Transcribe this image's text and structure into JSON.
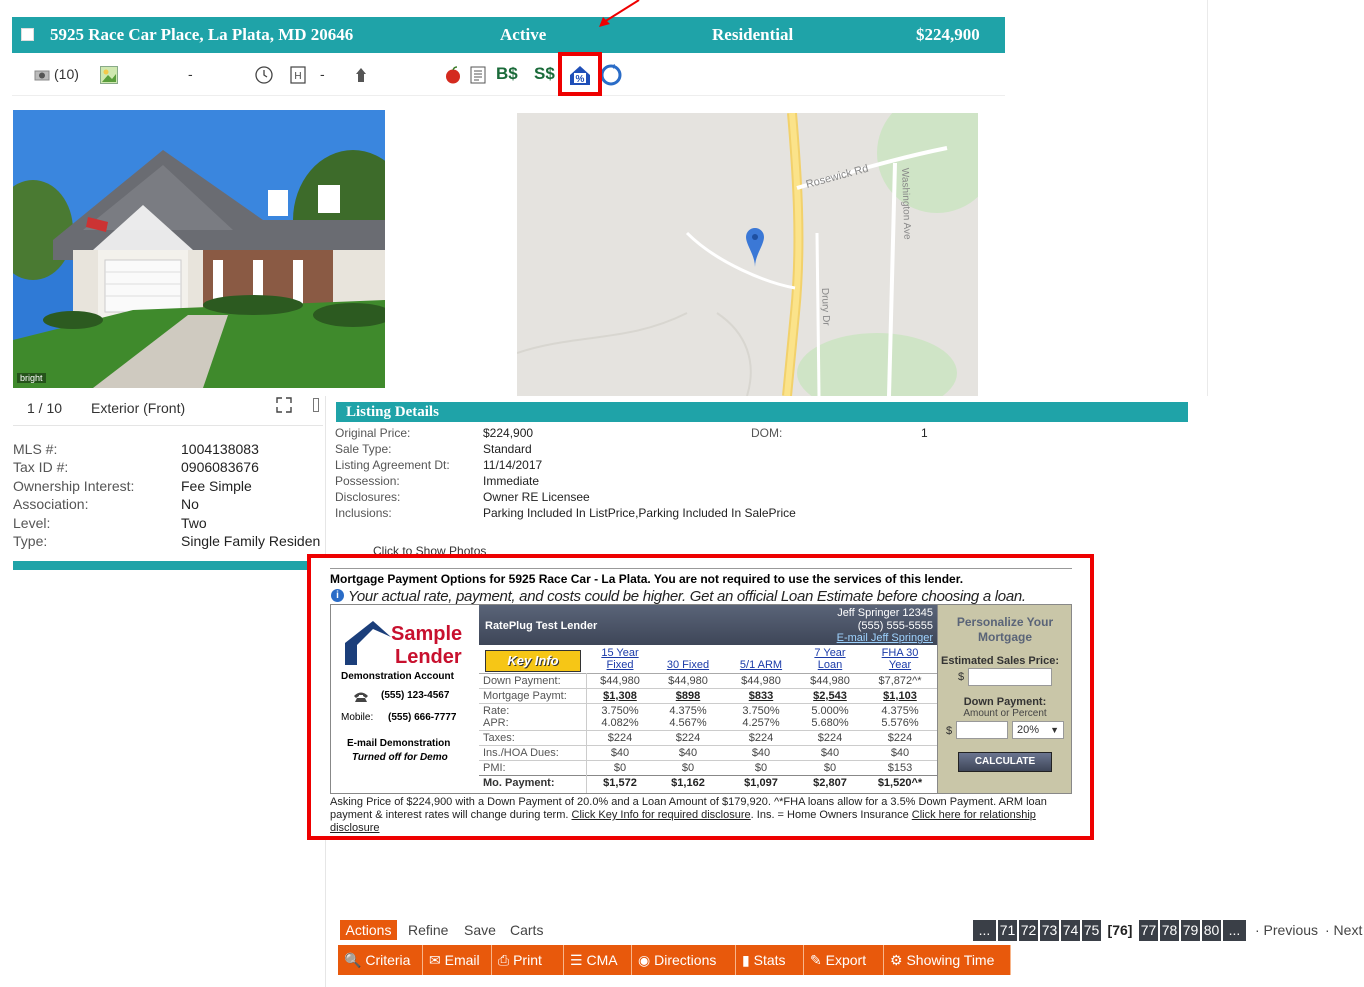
{
  "header": {
    "address": "5925 Race Car Place, La Plata, MD 20646",
    "status": "Active",
    "type": "Residential",
    "price": "$224,900"
  },
  "icon_row": {
    "photo_count": "(10)",
    "dash1": "-",
    "dash2": "-",
    "bs_label": "B$",
    "ss_label": "S$",
    "icons": [
      "camera-icon",
      "image-icon",
      "clock-icon",
      "hotel-icon",
      "person-icon",
      "apple-icon",
      "document-icon",
      "mortgage-percent-icon",
      "refresh-icon"
    ]
  },
  "photo": {
    "counter": "1 / 10",
    "caption": "Exterior (Front)",
    "watermark": "bright"
  },
  "map": {
    "roads": [
      "Rosewick Rd",
      "Washington Ave",
      "Drury Dr"
    ]
  },
  "facts": [
    {
      "label": "MLS #:",
      "value": "1004138083"
    },
    {
      "label": "Tax ID #:",
      "value": "0906083676"
    },
    {
      "label": "Ownership Interest:",
      "value": "Fee Simple"
    },
    {
      "label": "Association:",
      "value": "No"
    },
    {
      "label": "Level:",
      "value": "Two"
    },
    {
      "label": "Type:",
      "value": "Single Family Residen"
    }
  ],
  "listing_details": {
    "title": "Listing Details",
    "rows": [
      {
        "label": "Original Price:",
        "value": "$224,900"
      },
      {
        "label": "Sale Type:",
        "value": "Standard"
      },
      {
        "label": "Listing Agreement Dt:",
        "value": "11/14/2017"
      },
      {
        "label": "Possession:",
        "value": "Immediate"
      },
      {
        "label": "Disclosures:",
        "value": "Owner RE Licensee"
      },
      {
        "label": "Inclusions:",
        "value": "Parking Included In ListPrice,Parking Included In SalePrice"
      }
    ],
    "dom_label": "DOM:",
    "dom_value": "1",
    "click_photos": "Click to Show Photos"
  },
  "mortgage": {
    "title": "Mortgage Payment Options for 5925 Race Car - La Plata. You are not required to use the services of this lender.",
    "disclaimer": "Your actual rate, payment, and costs could be higher. Get an official Loan Estimate before choosing a loan.",
    "lender": {
      "logo_top": "Sample",
      "logo_bottom": "Lender",
      "account": "Demonstration Account",
      "phone": "(555) 123-4567",
      "mobile_label": "Mobile:",
      "mobile": "(555) 666-7777",
      "email": "E-mail Demonstration",
      "email_note": "Turned off for Demo"
    },
    "rate_header": {
      "name": "RatePlug Test Lender",
      "agent": "Jeff Springer 12345",
      "agent_phone": "(555) 555-5555",
      "agent_email": "E-mail Jeff Springer",
      "key_info": "Key Info"
    },
    "row_labels": [
      "Down Payment:",
      "Mortgage Paymt:",
      "Rate:",
      "APR:",
      "Taxes:",
      "Ins./HOA Dues:",
      "PMI:",
      "Mo. Payment:"
    ],
    "columns": [
      {
        "h1": "15 Year",
        "h2": "Fixed",
        "down": "$44,980",
        "pmt": "$1,308",
        "rate": "3.750%",
        "apr": "4.082%",
        "taxes": "$224",
        "ins": "$40",
        "pmi": "$0",
        "mo": "$1,572"
      },
      {
        "h1": "",
        "h2": "30 Fixed",
        "down": "$44,980",
        "pmt": "$898",
        "rate": "4.375%",
        "apr": "4.567%",
        "taxes": "$224",
        "ins": "$40",
        "pmi": "$0",
        "mo": "$1,162"
      },
      {
        "h1": "",
        "h2": "5/1 ARM",
        "down": "$44,980",
        "pmt": "$833",
        "rate": "3.750%",
        "apr": "4.257%",
        "taxes": "$224",
        "ins": "$40",
        "pmi": "$0",
        "mo": "$1,097"
      },
      {
        "h1": "7 Year",
        "h2": "Loan",
        "down": "$44,980",
        "pmt": "$2,543",
        "rate": "5.000%",
        "apr": "5.680%",
        "taxes": "$224",
        "ins": "$40",
        "pmi": "$0",
        "mo": "$2,807"
      },
      {
        "h1": "FHA 30",
        "h2": "Year",
        "down": "$7,872^*",
        "pmt": "$1,103",
        "rate": "4.375%",
        "apr": "5.576%",
        "taxes": "$224",
        "ins": "$40",
        "pmi": "$153",
        "mo": "$1,520^*"
      }
    ],
    "personalize": {
      "title1": "Personalize Your",
      "title2": "Mortgage",
      "est_label": "Estimated Sales Price:",
      "currency": "$",
      "down_label": "Down Payment:",
      "down_sub": "Amount or Percent",
      "percent": "20%",
      "calculate": "CALCULATE"
    },
    "footer_text": "Asking Price of $224,900 with a Down Payment of 20.0% and a Loan Amount of $179,920. ^*FHA loans allow for a 3.5% Down Payment. ARM loan payment & interest rates will change during term.",
    "footer_link1": "Click Key Info for required disclosure",
    "footer_mid": ". Ins. = Home Owners Insurance",
    "footer_link2": "Click here for relationship disclosure"
  },
  "bottom": {
    "tabs": [
      "Actions",
      "Refine",
      "Save",
      "Carts"
    ],
    "toolbar": [
      "Criteria",
      "Email",
      "Print",
      "CMA",
      "Directions",
      "Stats",
      "Export",
      "Showing Time"
    ],
    "pager": [
      "...",
      "71",
      "72",
      "73",
      "74",
      "75",
      "[76]",
      "77",
      "78",
      "79",
      "80",
      "..."
    ],
    "prev": "· Previous",
    "next": "· Next"
  },
  "colors": {
    "teal": "#1fa3a8",
    "orange": "#e8590c",
    "highlight_red": "#ee0000"
  }
}
